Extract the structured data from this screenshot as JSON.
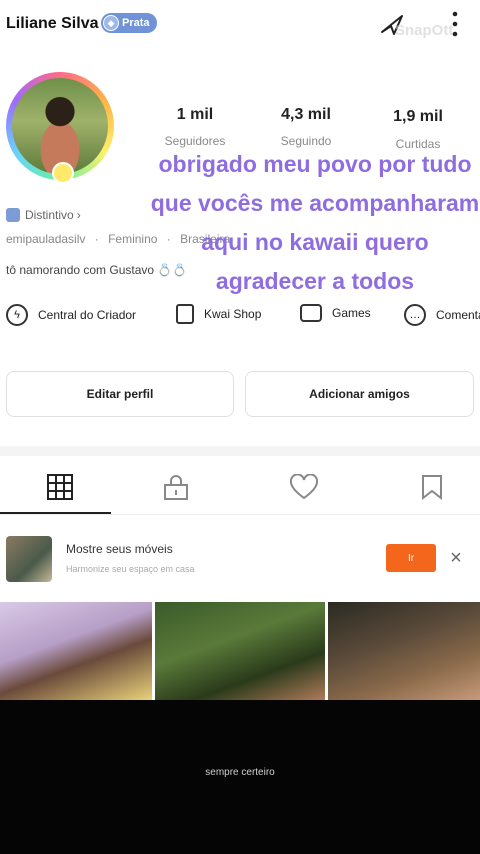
{
  "header": {
    "user_name": "Liliane Silva",
    "badge_label": "Prata",
    "watermark": "SnapOtt"
  },
  "stats": [
    {
      "value": "1 mil",
      "label": "Seguidores"
    },
    {
      "value": "4,3 mil",
      "label": "Seguindo"
    },
    {
      "value": "1,9 mil",
      "label": "Curtidas"
    }
  ],
  "overlay_text": "obrigado meu povo por tudo que vocês me acompanharam aqui no kawaii quero agradecer a todos",
  "profile": {
    "distintivo": "Distintivo",
    "username": "emipauladasilv",
    "gender": "Feminino",
    "extra": "Brasileira",
    "bio": "tô namorando com Gustavo 💍💍"
  },
  "shortcuts": {
    "creator": "Central do Criador",
    "shop": "Kwai Shop",
    "games": "Games",
    "comments": "Comentários"
  },
  "buttons": {
    "edit": "Editar perfil",
    "add_friends": "Adicionar amigos"
  },
  "tabs": [
    "grid-icon",
    "lock-icon",
    "heart-icon",
    "bookmark-icon"
  ],
  "ad": {
    "title": "Mostre seus móveis",
    "subtitle": "Harmonize seu espaço em casa",
    "button": "Ir",
    "close": "×"
  },
  "video_caption": "sempre certeiro",
  "colors": {
    "accent_orange": "#f4661b",
    "overlay_purple": "#8f6de0",
    "badge_blue": "#6f93d6"
  }
}
